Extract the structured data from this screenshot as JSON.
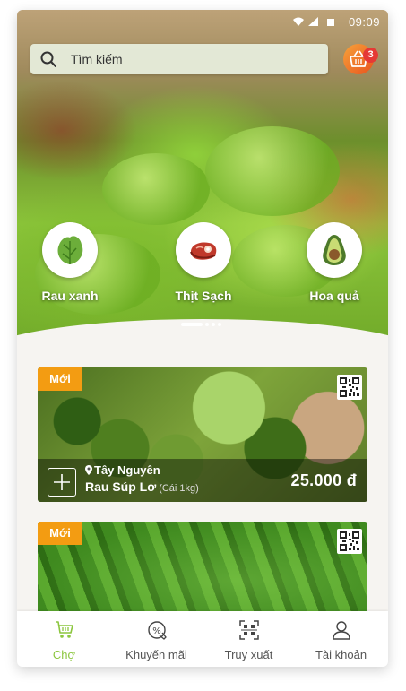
{
  "status_bar": {
    "time": "09:09"
  },
  "search": {
    "placeholder": "Tìm kiếm"
  },
  "cart": {
    "count": "3"
  },
  "categories": [
    {
      "label": "Rau xanh",
      "icon": "lettuce-icon"
    },
    {
      "label": "Thịt Sạch",
      "icon": "meat-icon"
    },
    {
      "label": "Hoa quả",
      "icon": "avocado-icon"
    }
  ],
  "carousel": {
    "pages": 4,
    "active": 0
  },
  "products": [
    {
      "tag": "Mới",
      "origin": "Tây Nguyên",
      "name": "Rau Súp Lơ",
      "unit": "(Cái 1kg)",
      "price": "25.000 đ"
    },
    {
      "tag": "Mới"
    }
  ],
  "bottom_nav": [
    {
      "label": "Chợ",
      "icon": "cart-icon",
      "active": true
    },
    {
      "label": "Khuyến mãi",
      "icon": "promo-icon",
      "active": false
    },
    {
      "label": "Truy xuất",
      "icon": "qr-scan-icon",
      "active": false
    },
    {
      "label": "Tài khoản",
      "icon": "user-icon",
      "active": false
    }
  ],
  "colors": {
    "accent": "#8cc63f",
    "tag": "#f39c12",
    "badge": "#e53935"
  }
}
